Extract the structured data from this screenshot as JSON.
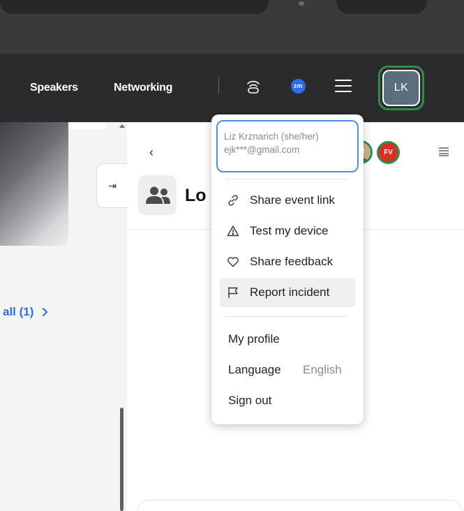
{
  "navbar": {
    "links": [
      "Speakers",
      "Networking"
    ],
    "zm_badge": "zm",
    "avatar_initials": "LK"
  },
  "sidebar": {
    "see_all_label": "all (1)",
    "collapse_glyph": "⇥"
  },
  "panel": {
    "back_glyph": "‹",
    "title": "Lo",
    "participant_badge": "FV"
  },
  "menu": {
    "user": {
      "name": "Liz Krznarich (she/her)",
      "email": "ejk***@gmail.com"
    },
    "actions": [
      {
        "label": "Share event link",
        "icon": "link-icon"
      },
      {
        "label": "Test my device",
        "icon": "warning-icon"
      },
      {
        "label": "Share feedback",
        "icon": "heart-icon"
      },
      {
        "label": "Report incident",
        "icon": "flag-icon",
        "highlighted": true
      }
    ],
    "my_profile": "My profile",
    "language_label": "Language",
    "language_value": "English",
    "sign_out": "Sign out"
  },
  "colors": {
    "accent_blue": "#2d6cf0",
    "avatar_ring_green": "#2f8f4a",
    "avatar_bg": "#5a6e7b",
    "nav_bg": "#2b2b2e",
    "fv_red": "#d93025"
  }
}
